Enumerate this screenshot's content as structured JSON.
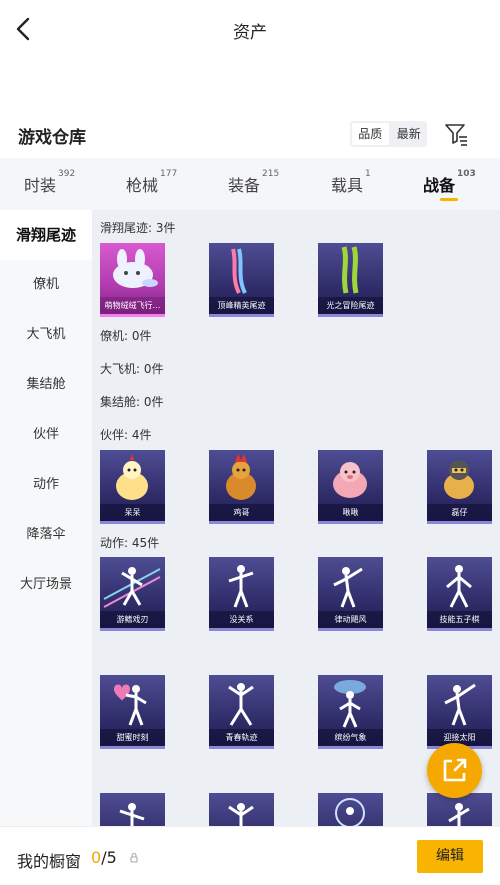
{
  "header": {
    "title": "资产"
  },
  "warehouse": {
    "title": "游戏仓库",
    "sort_options": [
      "品质",
      "最新"
    ]
  },
  "tabs": [
    {
      "label": "时装",
      "count": "392"
    },
    {
      "label": "枪械",
      "count": "177"
    },
    {
      "label": "装备",
      "count": "215"
    },
    {
      "label": "载具",
      "count": "1"
    },
    {
      "label": "战备",
      "count": "103"
    }
  ],
  "sidebar": {
    "items": [
      {
        "label": "滑翔尾迹"
      },
      {
        "label": "僚机"
      },
      {
        "label": "大飞机"
      },
      {
        "label": "集结舱"
      },
      {
        "label": "伙伴"
      },
      {
        "label": "动作"
      },
      {
        "label": "降落伞"
      },
      {
        "label": "大厅场景"
      }
    ]
  },
  "sections": [
    {
      "label": "滑翔尾迹: 3件",
      "items": [
        "萌物绒绒飞行…",
        "顶峰精英尾迹",
        "光之冒险尾迹"
      ]
    },
    {
      "label": "僚机: 0件"
    },
    {
      "label": "大飞机: 0件"
    },
    {
      "label": "集结舱: 0件"
    },
    {
      "label": "伙伴: 4件",
      "items": [
        "呆呆",
        "鸡哥",
        "啾啾",
        "磊仔"
      ]
    },
    {
      "label": "动作: 45件",
      "items": [
        "游鳍戏刃",
        "没关系",
        "律动飓风",
        "技能五子棋",
        "甜蜜时刻",
        "青春轨迹",
        "缤纷气象",
        "迎接太阳"
      ]
    }
  ],
  "bottom": {
    "label": "我的橱窗",
    "count_current": "0",
    "count_total": "/5",
    "edit_label": "编辑"
  },
  "colors": {
    "accent": "#f8b400",
    "card_rare": "#2f2c69",
    "card_epic": "#b13bb0"
  }
}
